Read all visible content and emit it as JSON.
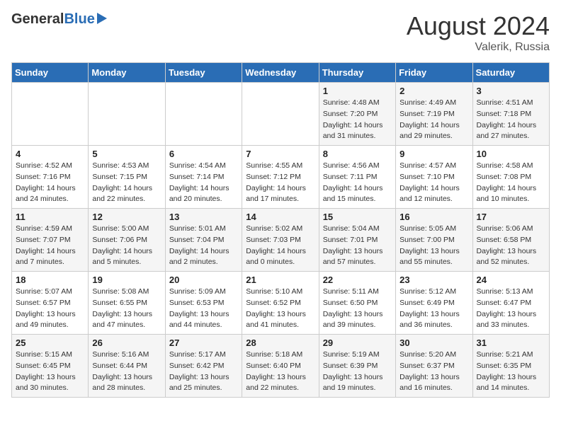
{
  "header": {
    "logo_general": "General",
    "logo_blue": "Blue",
    "month_year": "August 2024",
    "location": "Valerik, Russia"
  },
  "weekdays": [
    "Sunday",
    "Monday",
    "Tuesday",
    "Wednesday",
    "Thursday",
    "Friday",
    "Saturday"
  ],
  "weeks": [
    [
      {
        "day": "",
        "info": ""
      },
      {
        "day": "",
        "info": ""
      },
      {
        "day": "",
        "info": ""
      },
      {
        "day": "",
        "info": ""
      },
      {
        "day": "1",
        "info": "Sunrise: 4:48 AM\nSunset: 7:20 PM\nDaylight: 14 hours\nand 31 minutes."
      },
      {
        "day": "2",
        "info": "Sunrise: 4:49 AM\nSunset: 7:19 PM\nDaylight: 14 hours\nand 29 minutes."
      },
      {
        "day": "3",
        "info": "Sunrise: 4:51 AM\nSunset: 7:18 PM\nDaylight: 14 hours\nand 27 minutes."
      }
    ],
    [
      {
        "day": "4",
        "info": "Sunrise: 4:52 AM\nSunset: 7:16 PM\nDaylight: 14 hours\nand 24 minutes."
      },
      {
        "day": "5",
        "info": "Sunrise: 4:53 AM\nSunset: 7:15 PM\nDaylight: 14 hours\nand 22 minutes."
      },
      {
        "day": "6",
        "info": "Sunrise: 4:54 AM\nSunset: 7:14 PM\nDaylight: 14 hours\nand 20 minutes."
      },
      {
        "day": "7",
        "info": "Sunrise: 4:55 AM\nSunset: 7:12 PM\nDaylight: 14 hours\nand 17 minutes."
      },
      {
        "day": "8",
        "info": "Sunrise: 4:56 AM\nSunset: 7:11 PM\nDaylight: 14 hours\nand 15 minutes."
      },
      {
        "day": "9",
        "info": "Sunrise: 4:57 AM\nSunset: 7:10 PM\nDaylight: 14 hours\nand 12 minutes."
      },
      {
        "day": "10",
        "info": "Sunrise: 4:58 AM\nSunset: 7:08 PM\nDaylight: 14 hours\nand 10 minutes."
      }
    ],
    [
      {
        "day": "11",
        "info": "Sunrise: 4:59 AM\nSunset: 7:07 PM\nDaylight: 14 hours\nand 7 minutes."
      },
      {
        "day": "12",
        "info": "Sunrise: 5:00 AM\nSunset: 7:06 PM\nDaylight: 14 hours\nand 5 minutes."
      },
      {
        "day": "13",
        "info": "Sunrise: 5:01 AM\nSunset: 7:04 PM\nDaylight: 14 hours\nand 2 minutes."
      },
      {
        "day": "14",
        "info": "Sunrise: 5:02 AM\nSunset: 7:03 PM\nDaylight: 14 hours\nand 0 minutes."
      },
      {
        "day": "15",
        "info": "Sunrise: 5:04 AM\nSunset: 7:01 PM\nDaylight: 13 hours\nand 57 minutes."
      },
      {
        "day": "16",
        "info": "Sunrise: 5:05 AM\nSunset: 7:00 PM\nDaylight: 13 hours\nand 55 minutes."
      },
      {
        "day": "17",
        "info": "Sunrise: 5:06 AM\nSunset: 6:58 PM\nDaylight: 13 hours\nand 52 minutes."
      }
    ],
    [
      {
        "day": "18",
        "info": "Sunrise: 5:07 AM\nSunset: 6:57 PM\nDaylight: 13 hours\nand 49 minutes."
      },
      {
        "day": "19",
        "info": "Sunrise: 5:08 AM\nSunset: 6:55 PM\nDaylight: 13 hours\nand 47 minutes."
      },
      {
        "day": "20",
        "info": "Sunrise: 5:09 AM\nSunset: 6:53 PM\nDaylight: 13 hours\nand 44 minutes."
      },
      {
        "day": "21",
        "info": "Sunrise: 5:10 AM\nSunset: 6:52 PM\nDaylight: 13 hours\nand 41 minutes."
      },
      {
        "day": "22",
        "info": "Sunrise: 5:11 AM\nSunset: 6:50 PM\nDaylight: 13 hours\nand 39 minutes."
      },
      {
        "day": "23",
        "info": "Sunrise: 5:12 AM\nSunset: 6:49 PM\nDaylight: 13 hours\nand 36 minutes."
      },
      {
        "day": "24",
        "info": "Sunrise: 5:13 AM\nSunset: 6:47 PM\nDaylight: 13 hours\nand 33 minutes."
      }
    ],
    [
      {
        "day": "25",
        "info": "Sunrise: 5:15 AM\nSunset: 6:45 PM\nDaylight: 13 hours\nand 30 minutes."
      },
      {
        "day": "26",
        "info": "Sunrise: 5:16 AM\nSunset: 6:44 PM\nDaylight: 13 hours\nand 28 minutes."
      },
      {
        "day": "27",
        "info": "Sunrise: 5:17 AM\nSunset: 6:42 PM\nDaylight: 13 hours\nand 25 minutes."
      },
      {
        "day": "28",
        "info": "Sunrise: 5:18 AM\nSunset: 6:40 PM\nDaylight: 13 hours\nand 22 minutes."
      },
      {
        "day": "29",
        "info": "Sunrise: 5:19 AM\nSunset: 6:39 PM\nDaylight: 13 hours\nand 19 minutes."
      },
      {
        "day": "30",
        "info": "Sunrise: 5:20 AM\nSunset: 6:37 PM\nDaylight: 13 hours\nand 16 minutes."
      },
      {
        "day": "31",
        "info": "Sunrise: 5:21 AM\nSunset: 6:35 PM\nDaylight: 13 hours\nand 14 minutes."
      }
    ]
  ]
}
